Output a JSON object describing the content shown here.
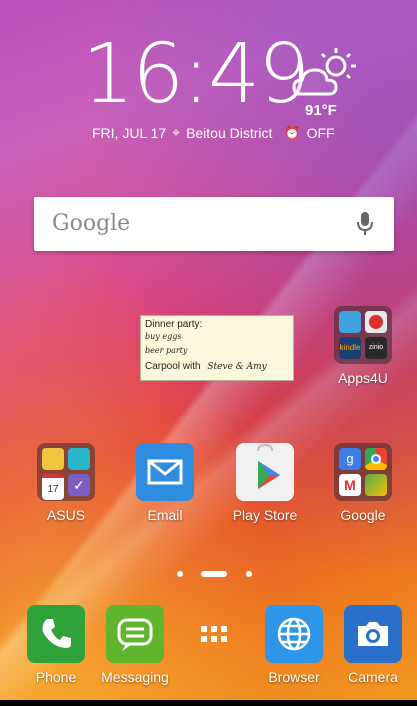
{
  "clock": {
    "time": "16:49"
  },
  "weather": {
    "temperature": "91°F",
    "icon": "partly-sunny-icon"
  },
  "status": {
    "date": "FRI, JUL 17",
    "location": "Beitou District",
    "alarm": "OFF"
  },
  "search": {
    "logo_text": "Google"
  },
  "memo": {
    "line1": "Dinner party:",
    "line2": "buy eggs",
    "line3": "beer party",
    "line4": "Carpool with",
    "line4_hand": "Steve & Amy"
  },
  "folders": {
    "apps4u": {
      "label": "Apps4U",
      "mini_labels": [
        "kindle",
        "zinio"
      ]
    },
    "asus": {
      "label": "ASUS",
      "calendar_day": "17"
    },
    "google": {
      "label": "Google"
    }
  },
  "apps": {
    "email": "Email",
    "play_store": "Play Store"
  },
  "dock": {
    "phone": "Phone",
    "messaging": "Messaging",
    "browser": "Browser",
    "camera": "Camera"
  },
  "colors": {
    "email_blue": "#2f8de0",
    "phone_green": "#2fa23a",
    "messaging_green": "#5fb52b",
    "browser_blue": "#2e96e8",
    "camera_blue": "#2a6fc9"
  }
}
